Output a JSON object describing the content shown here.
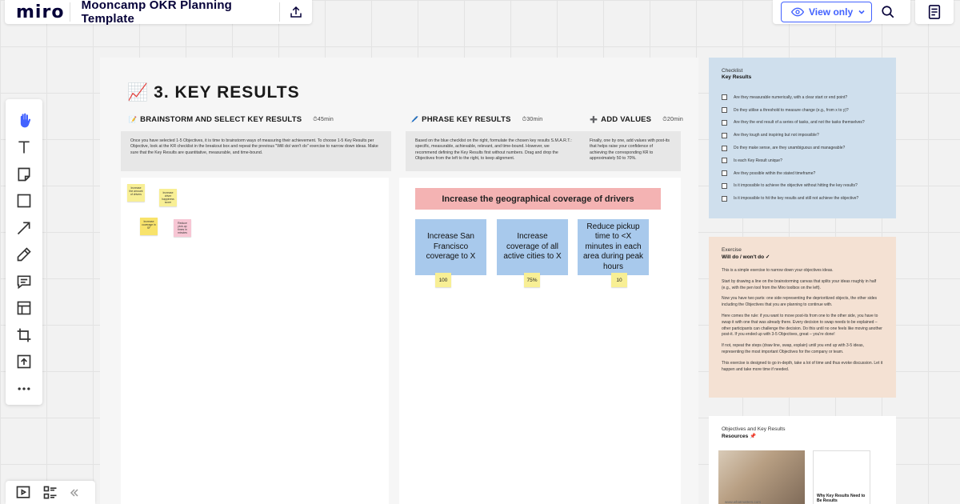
{
  "header": {
    "logo": "miro",
    "board_title": "Mooncamp OKR Planning Template",
    "view_only_label": "View only"
  },
  "frame": {
    "title_emoji": "📈",
    "title": "3. KEY RESULTS",
    "sections": [
      {
        "icon": "📝",
        "label": "BRAINSTORM AND SELECT KEY RESULTS",
        "time": "45min",
        "instructions": "Once you have selected 1-5 Objectives, it is time to brainstorm ways of measuring their achievement. To choose 1-5 Key Results per Objective, look at the KR checklist in the breakout box and repeat the previous \"Will do/ won't do\" exercise to narrow down ideas. Make sure that the Key Results are quantitative, measurable, and time-bound."
      },
      {
        "icon": "🖊️",
        "label": "PHRASE KEY RESULTS",
        "time": "30min",
        "instructions": "Based on the blue checklist on the right, formulate the chosen key results S.M.A.R.T.: specific, measurable, achievable, relevant, and time-bound. However, we recommend defining the Key Results first without numbers. Drag and drop the Objectives from the left to the right, to keep alignment."
      },
      {
        "icon": "➕",
        "label": "ADD VALUES",
        "time": "20min",
        "instructions": "Finally, one by one, add values with post-its that helps raise your confidence of achieving the corresponding KR to approximately 50 to 70%."
      }
    ],
    "stickies": [
      {
        "text": "Increase the amount of drivers",
        "color": "#f8ef95"
      },
      {
        "text": "Increase driver happiness score",
        "color": "#f8ef95"
      },
      {
        "text": "Increase coverage in SF",
        "color": "#f8e36b"
      },
      {
        "text": "Reduce pick-up times in minutes",
        "color": "#f7c6d4"
      }
    ],
    "objective": "Increase the geographical coverage of drivers",
    "key_results": [
      {
        "text": "Increase San Francisco coverage to X",
        "value": "100"
      },
      {
        "text": "Increase coverage of all active cities to X",
        "value": "75%"
      },
      {
        "text": "Reduce pickup time to <X minutes in each area during peak hours",
        "value": "10"
      }
    ]
  },
  "checklist": {
    "title": "Checklist",
    "subtitle": "Key Results",
    "items": [
      "Are they measurable numerically, with a clear start or end point?",
      "Do they utilise a threshold to measure change (e.g., from x to y)?",
      "Are they the end result of a series of tasks, and not the tasks themselves?",
      "Are they tough and inspiring but not impossible?",
      "Do they make sense, are they unambiguous and manageable?",
      "Is each Key Result unique?",
      "Are they possible within the stated timeframe?",
      "Is it impossible to achieve the objective without hitting the key results?",
      "Is it impossible to hit the key results and still not achieve the objective?"
    ]
  },
  "exercise": {
    "title": "Exercise",
    "subtitle": "Will do / won't do ✓",
    "paragraphs": [
      "This is a simple exercise to narrow down your objectives ideas.",
      "Start by drawing a line on the brainstorming canvas that splits your ideas roughly in half (e.g., with the pen tool from the Miro toolbox on the left).",
      "Now you have two parts: one side representing the deprioritized objects, the other sides including the Objectives that you are planning to continue with.",
      "Here comes the rule: if you want to move post-its from one to the other side, you have to swap it with one that was already there. Every decision to swap needs to be explained – other participants can challenge the decision. Do this until no one feels like moving another post-it. If you ended up with 3-5 Objectives, great – you're done!",
      "If not, repeat the steps (draw line, swap, explain) until you end up with 3-5 ideas, representing the most important Objectives for the company or team.",
      "This exercise is designed to go in-depth, take a lot of time and thus evoke discussion. Let it happen and take more time if needed."
    ]
  },
  "resources": {
    "title": "Objectives and Key Results",
    "subtitle": "Resources 📌",
    "link1": "www.whatmatters.com",
    "link2": "Why Key Results Need to Be Results"
  },
  "colors": {
    "accent": "#4262ff",
    "checklist_bg": "#cfdfed",
    "exercise_bg": "#f4e1d3",
    "objective_bg": "#f4b3b3",
    "kr_bg": "#a8c9ec",
    "sticky_yellow": "#f8ef95"
  }
}
